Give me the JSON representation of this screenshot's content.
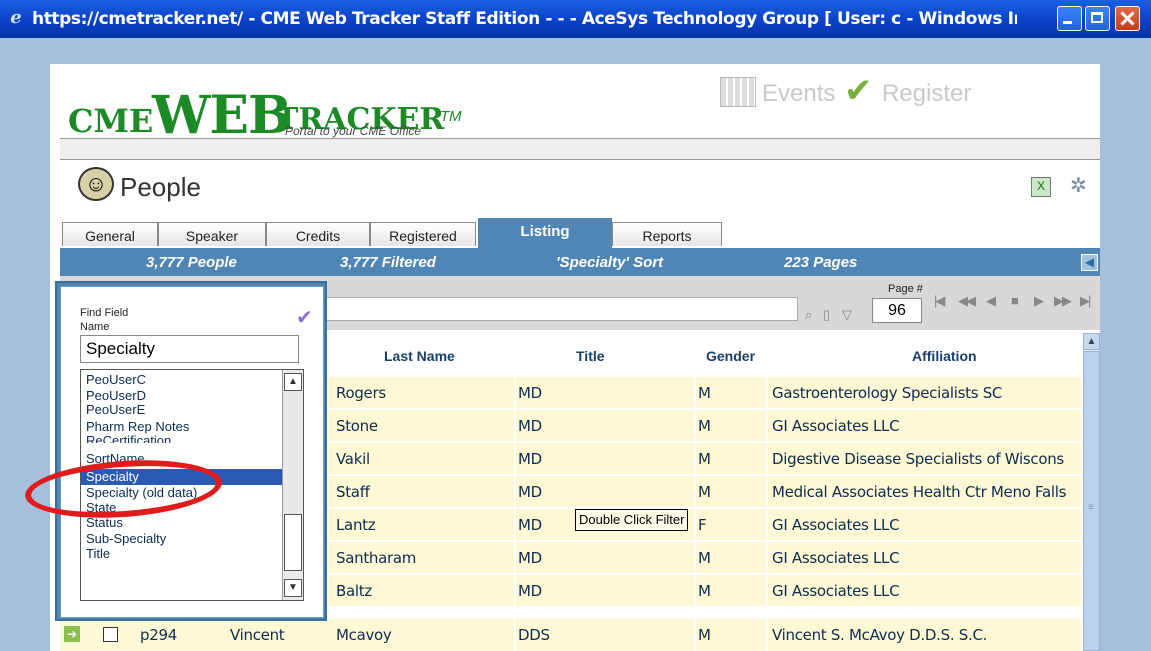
{
  "window": {
    "title": "https://cmetracker.net/ - CME Web Tracker Staff Edition - - - AceSys Technology Group [ User: c - Windows Inte..."
  },
  "header": {
    "logo": {
      "cme": "CME",
      "web": "WEB",
      "tracker": "TRACKER",
      "tm": "TM"
    },
    "tagline": "Portal to your CME Office",
    "events_label": "Events",
    "register_label": "Register"
  },
  "page": {
    "title": "People"
  },
  "tabs": [
    {
      "label": "General",
      "active": false
    },
    {
      "label": "Speaker",
      "active": false
    },
    {
      "label": "Credits",
      "active": false
    },
    {
      "label": "Registered",
      "active": false
    },
    {
      "label": "Listing",
      "active": true
    },
    {
      "label": "Reports",
      "active": false
    }
  ],
  "status": {
    "people": "3,777 People",
    "filtered": "3,777 Filtered",
    "sort": "'Specialty' Sort",
    "pages": "223 Pages"
  },
  "pager": {
    "label": "Page #",
    "value": "96"
  },
  "table": {
    "columns": [
      "Last Name",
      "Title",
      "Gender",
      "Affiliation"
    ],
    "rows": [
      {
        "last_name": "Rogers",
        "title": "MD",
        "gender": "M",
        "affiliation": "Gastroenterology Specialists SC"
      },
      {
        "last_name": "Stone",
        "title": "MD",
        "gender": "M",
        "affiliation": "GI Associates LLC"
      },
      {
        "last_name": "Vakil",
        "title": "MD",
        "gender": "M",
        "affiliation": "Digestive Disease Specialists of Wiscons"
      },
      {
        "last_name": "Staff",
        "title": "MD",
        "gender": "M",
        "affiliation": "Medical Associates Health Ctr Meno Falls"
      },
      {
        "last_name": "Lantz",
        "title": "MD",
        "gender": "F",
        "affiliation": "GI Associates LLC"
      },
      {
        "last_name": "Santharam",
        "title": "MD",
        "gender": "M",
        "affiliation": "GI Associates LLC"
      },
      {
        "last_name": "Baltz",
        "title": "MD",
        "gender": "M",
        "affiliation": "GI Associates LLC"
      }
    ],
    "last_row": {
      "id": "p294",
      "first_name": "Vincent",
      "last_name": "Mcavoy",
      "title": "DDS",
      "gender": "M",
      "affiliation": "Vincent S. McAvoy D.D.S. S.C."
    }
  },
  "finder": {
    "label": "Find Field Name",
    "value": "Specialty",
    "options": [
      "PeoUserC",
      "PeoUserD",
      "PeoUserE",
      "Pharm Rep Notes",
      "ReCertification",
      "SortName",
      "Specialty",
      "Specialty (old data)",
      "State",
      "Status",
      "Sub-Specialty",
      "Title"
    ],
    "selected_index": 6
  },
  "tooltip": "Double Click Filter"
}
